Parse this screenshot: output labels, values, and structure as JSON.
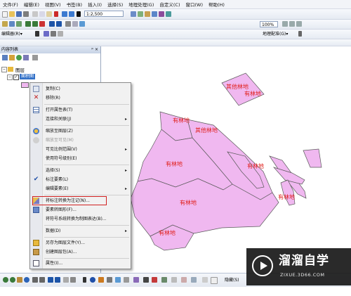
{
  "menubar": [
    "文件(F)",
    "编辑(E)",
    "视图(V)",
    "书签(B)",
    "插入(I)",
    "选择(S)",
    "地理处理(G)",
    "自定义(C)",
    "窗口(W)",
    "帮助(H)"
  ],
  "toolbar": {
    "scale": "1:2,500",
    "zoom": "100%",
    "editor_label": "编辑器(R)▾",
    "georef_label": "地理配准(G)▾",
    "layers_label": "图层:"
  },
  "toc": {
    "title": "内容列表",
    "layers_root": "图层",
    "layer_name": "面积图"
  },
  "context_menu": {
    "items": [
      {
        "label": "复制(C)",
        "icon": "copy-icon"
      },
      {
        "label": "移除(R)",
        "icon": "remove-icon"
      },
      {
        "label": "打开属性表(T)",
        "icon": "table-icon"
      },
      {
        "label": "连接和关联(J)",
        "icon": "",
        "arrow": "▸"
      },
      {
        "label": "缩放至图层(Z)",
        "icon": "zoom-layer-icon"
      },
      {
        "label": "缩放至可见(M)",
        "icon": "zoom-visible-icon",
        "disabled": true
      },
      {
        "label": "可见比例范围(V)",
        "icon": "",
        "arrow": "▸"
      },
      {
        "label": "使用符号级别(E)",
        "icon": ""
      },
      {
        "label": "选择(S)",
        "icon": "",
        "arrow": "▸"
      },
      {
        "label": "标注要素(L)",
        "icon": "check-icon"
      },
      {
        "label": "编辑要素(E)",
        "icon": "",
        "arrow": "▸"
      },
      {
        "label": "将标注转换为注记(N)...",
        "icon": "convert-annotation-icon"
      },
      {
        "label": "要素转图形(F)...",
        "icon": "feature-graphic-icon"
      },
      {
        "label": "将符号系统转换为制图表达(B)...",
        "icon": ""
      },
      {
        "label": "数据(D)",
        "icon": "",
        "arrow": "▸"
      },
      {
        "label": "另存为图层文件(Y)...",
        "icon": "save-layer-icon"
      },
      {
        "label": "创建图层包(A)...",
        "icon": "package-icon"
      },
      {
        "label": "属性(I)...",
        "icon": "properties-icon"
      }
    ]
  },
  "map": {
    "labels": [
      "其他林地",
      "其他林地",
      "有林地",
      "有林地",
      "有林地",
      "有林地",
      "有林地",
      "有林地",
      "有林地"
    ],
    "fill_color": "#f0b8f0",
    "label_color": "#e0201c"
  },
  "bottom": {
    "layer_field": "隐藏(S)"
  },
  "watermark": {
    "title": "溜溜自学",
    "url": "ZIXUE.3D66.COM"
  },
  "colors": {
    "highlight_box": "#d02020"
  }
}
